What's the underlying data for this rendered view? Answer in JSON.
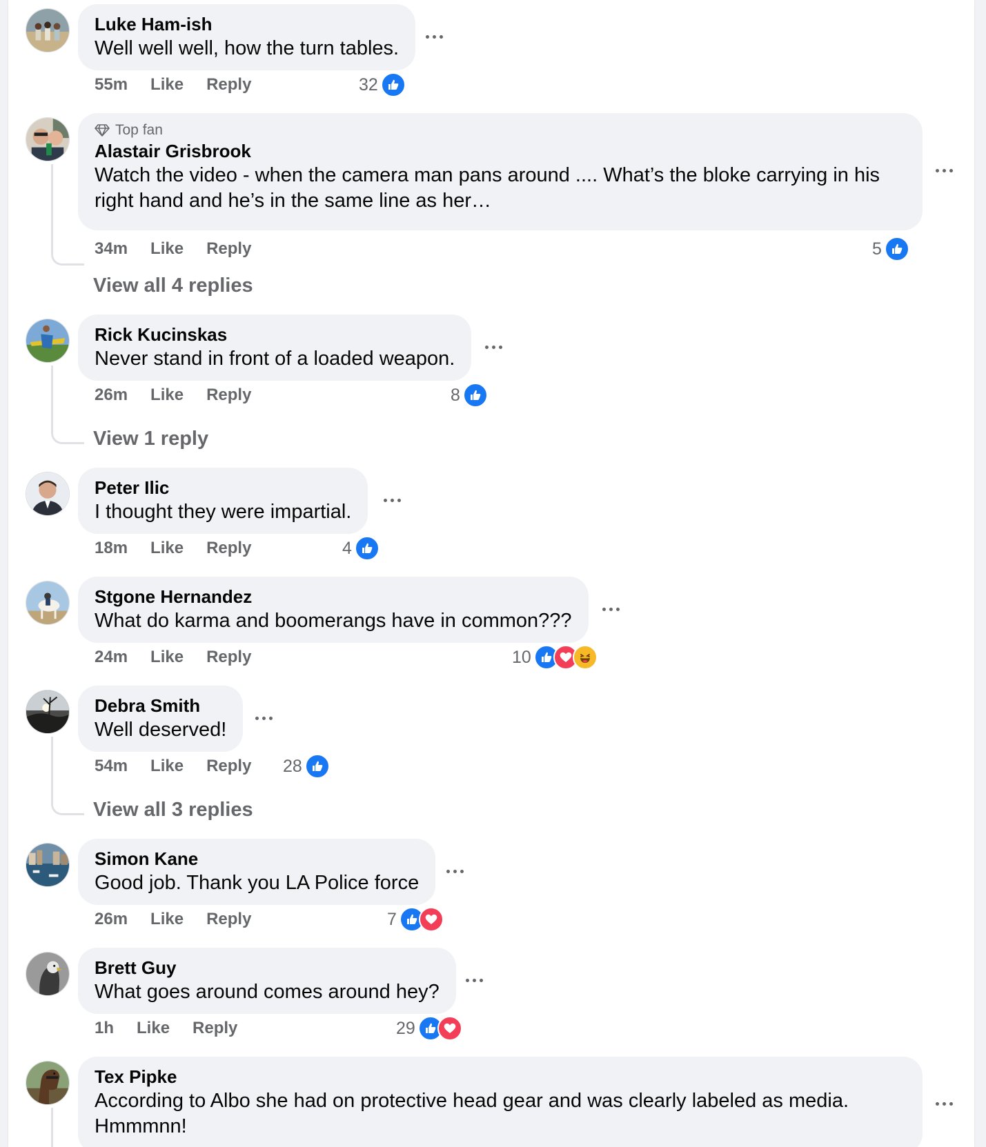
{
  "comments": [
    {
      "name": "Luke Ham-ish",
      "text": "Well well well, how the turn tables.",
      "time": "55m",
      "like_label": "Like",
      "reply_label": "Reply",
      "reaction_count": "32",
      "reactions": [
        "like"
      ],
      "avatar_icon": "group-photo-avatar"
    },
    {
      "badge": "Top fan",
      "badge_icon": "diamond-icon",
      "name": "Alastair Grisbrook",
      "text": "Watch the video - when the camera man pans around .... What’s the bloke carrying in his right hand and he’s in the same line as her…",
      "time": "34m",
      "like_label": "Like",
      "reply_label": "Reply",
      "reaction_count": "5",
      "reactions": [
        "like"
      ],
      "view_replies": "View all 4 replies",
      "avatar_icon": "selfie-avatar"
    },
    {
      "name": "Rick Kucinskas",
      "text": "Never stand in front of a loaded weapon.",
      "time": "26m",
      "like_label": "Like",
      "reply_label": "Reply",
      "reaction_count": "8",
      "reactions": [
        "like"
      ],
      "view_replies": "View 1 reply",
      "avatar_icon": "plane-avatar"
    },
    {
      "name": "Peter Ilic",
      "text": "I thought they were impartial.",
      "time": "18m",
      "like_label": "Like",
      "reply_label": "Reply",
      "reaction_count": "4",
      "reactions": [
        "like"
      ],
      "avatar_icon": "portrait-avatar"
    },
    {
      "name": "Stgone Hernandez",
      "text": "What do karma and boomerangs have in common???",
      "time": "24m",
      "like_label": "Like",
      "reply_label": "Reply",
      "reaction_count": "10",
      "reactions": [
        "like",
        "love",
        "haha"
      ],
      "avatar_icon": "horse-rider-avatar"
    },
    {
      "name": "Debra Smith",
      "text": "Well deserved!",
      "time": "54m",
      "like_label": "Like",
      "reply_label": "Reply",
      "reaction_count": "28",
      "reactions": [
        "like"
      ],
      "view_replies": "View all 3 replies",
      "avatar_icon": "sunset-tree-avatar"
    },
    {
      "name": "Simon Kane",
      "text": "Good job. Thank you LA Police force",
      "time": "26m",
      "like_label": "Like",
      "reply_label": "Reply",
      "reaction_count": "7",
      "reactions": [
        "like",
        "love"
      ],
      "avatar_icon": "harbour-avatar"
    },
    {
      "name": "Brett Guy",
      "text": "What goes around comes around hey?",
      "time": "1h",
      "like_label": "Like",
      "reply_label": "Reply",
      "reaction_count": "29",
      "reactions": [
        "like",
        "love"
      ],
      "avatar_icon": "eagle-avatar"
    },
    {
      "name": "Tex Pipke",
      "text": "According to Albo she had on protective head gear and was clearly labeled as media. Hmmmnn!",
      "avatar_icon": "horse-avatar"
    }
  ],
  "colors": {
    "bubble": "#f0f2f5",
    "like": "#1877f2",
    "love": "#f33e58",
    "haha": "#f7b928",
    "secondary_text": "#65676b"
  }
}
